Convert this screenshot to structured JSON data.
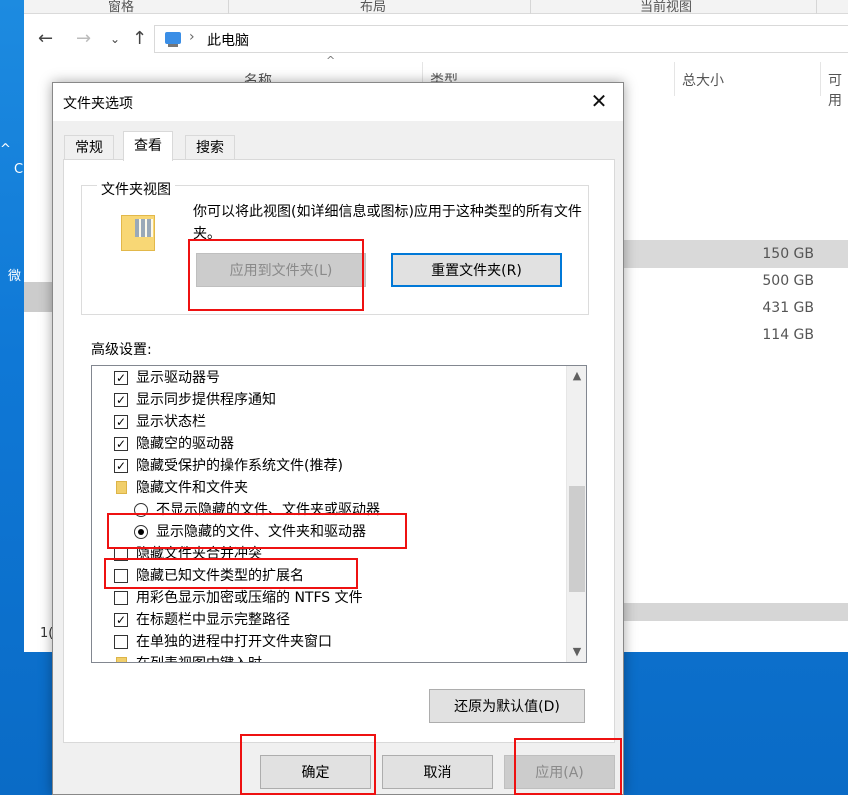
{
  "explorer": {
    "ribbon_groups": [
      "窗格",
      "布局",
      "当前视图"
    ],
    "breadcrumb": "此电脑",
    "columns": {
      "name": "名称",
      "type": "类型",
      "total_size": "总大小",
      "free": "可用"
    },
    "sizes": [
      "150 GB",
      "500 GB",
      "431 GB",
      "114 GB"
    ],
    "status_count": "1("
  },
  "desktop_glyphs": [
    "C",
    "微"
  ],
  "dialog": {
    "title": "文件夹选项",
    "tabs": [
      {
        "label": "常规",
        "active": false
      },
      {
        "label": "查看",
        "active": true
      },
      {
        "label": "搜索",
        "active": false
      }
    ],
    "folder_view": {
      "legend": "文件夹视图",
      "description": "你可以将此视图(如详细信息或图标)应用于这种类型的所有文件夹。",
      "apply_button": "应用到文件夹(L)",
      "reset_button": "重置文件夹(R)"
    },
    "advanced_label": "高级设置:",
    "advanced_items": [
      {
        "kind": "checkbox",
        "checked": true,
        "indent": 0,
        "label": "显示驱动器号"
      },
      {
        "kind": "checkbox",
        "checked": true,
        "indent": 0,
        "label": "显示同步提供程序通知"
      },
      {
        "kind": "checkbox",
        "checked": true,
        "indent": 0,
        "label": "显示状态栏"
      },
      {
        "kind": "checkbox",
        "checked": true,
        "indent": 0,
        "label": "隐藏空的驱动器"
      },
      {
        "kind": "checkbox",
        "checked": true,
        "indent": 0,
        "label": "隐藏受保护的操作系统文件(推荐)"
      },
      {
        "kind": "folder",
        "indent": 0,
        "label": "隐藏文件和文件夹"
      },
      {
        "kind": "radio",
        "checked": false,
        "indent": 1,
        "label": "不显示隐藏的文件、文件夹或驱动器"
      },
      {
        "kind": "radio",
        "checked": true,
        "indent": 1,
        "label": "显示隐藏的文件、文件夹和驱动器"
      },
      {
        "kind": "checkbox",
        "checked": false,
        "indent": 0,
        "label": "隐藏文件夹合并冲突"
      },
      {
        "kind": "checkbox",
        "checked": false,
        "indent": 0,
        "label": "隐藏已知文件类型的扩展名"
      },
      {
        "kind": "checkbox",
        "checked": false,
        "indent": 0,
        "label": "用彩色显示加密或压缩的 NTFS 文件"
      },
      {
        "kind": "checkbox",
        "checked": true,
        "indent": 0,
        "label": "在标题栏中显示完整路径"
      },
      {
        "kind": "checkbox",
        "checked": false,
        "indent": 0,
        "label": "在单独的进程中打开文件夹窗口"
      },
      {
        "kind": "folder",
        "indent": 0,
        "label": "在列表视图中键入时"
      }
    ],
    "restore_button": "还原为默认值(D)",
    "ok_button": "确定",
    "cancel_button": "取消",
    "apply_button": "应用(A)"
  },
  "colors": {
    "highlight": "#ee1111",
    "focus": "#0078d7",
    "desktop": "#0a72cf"
  }
}
